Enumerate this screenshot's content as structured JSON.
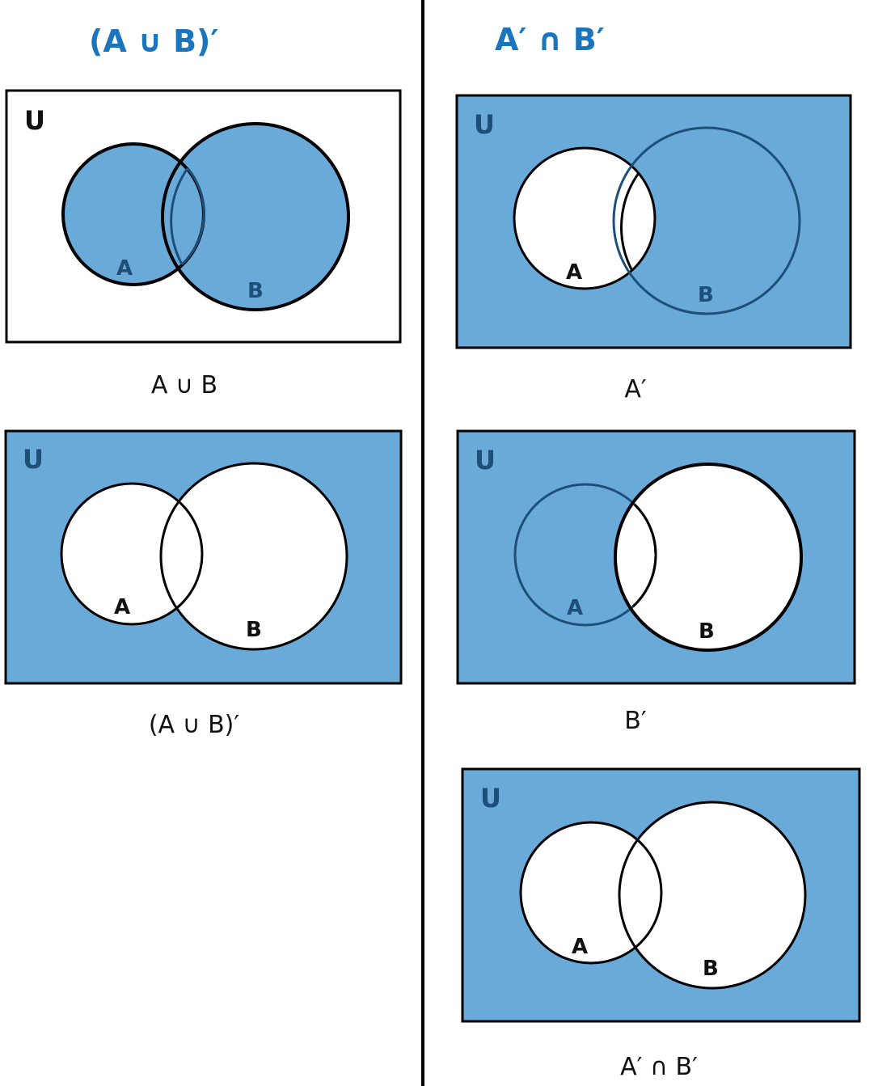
{
  "left_column": {
    "title": "(A ∪ B)′",
    "diagrams": [
      {
        "caption": "A ∪ B",
        "universe_label": "U",
        "set_a_label": "A",
        "set_b_label": "B",
        "shaded": "union"
      },
      {
        "caption": "(A ∪ B)′",
        "universe_label": "U",
        "set_a_label": "A",
        "set_b_label": "B",
        "shaded": "complement_of_union"
      }
    ]
  },
  "right_column": {
    "title": "A′ ∩ B′",
    "diagrams": [
      {
        "caption": "A′",
        "universe_label": "U",
        "set_a_label": "A",
        "set_b_label": "B",
        "shaded": "complement_of_a"
      },
      {
        "caption": "B′",
        "universe_label": "U",
        "set_a_label": "A",
        "set_b_label": "B",
        "shaded": "complement_of_b"
      },
      {
        "caption": "A′ ∩ B′",
        "universe_label": "U",
        "set_a_label": "A",
        "set_b_label": "B",
        "shaded": "intersection_of_complements"
      }
    ]
  },
  "colors": {
    "shade_blue": "#6aaad9",
    "heading_blue": "#1a75bc",
    "dark_blue_outline": "#1d4f78",
    "outline_black": "#000000"
  }
}
